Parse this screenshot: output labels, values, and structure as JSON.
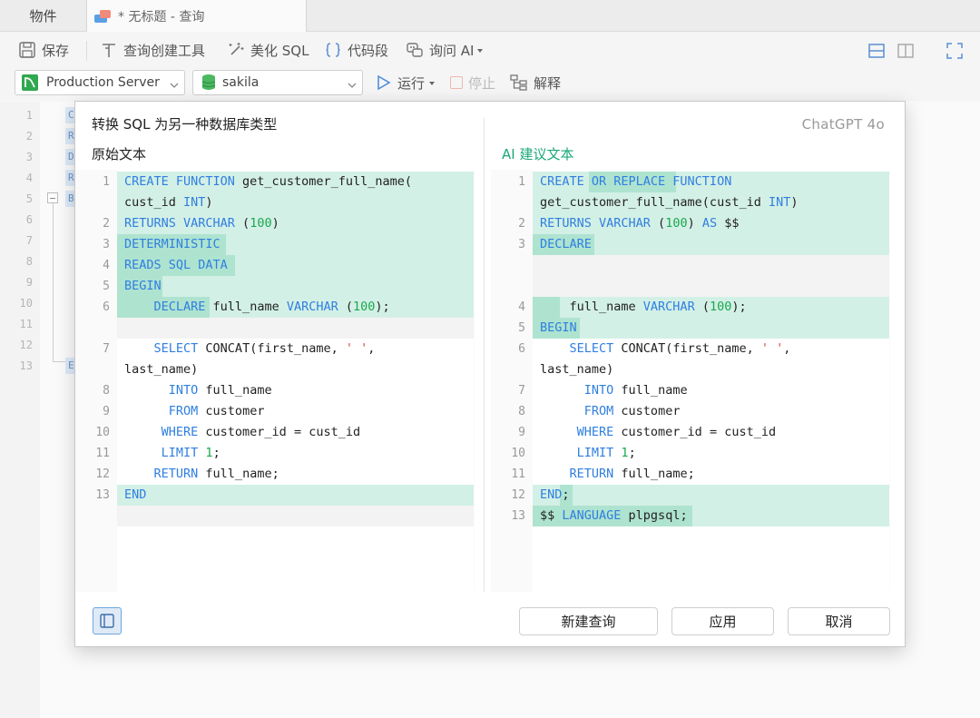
{
  "tabs": {
    "objects": "物件",
    "query": "* 无标题 - 查询"
  },
  "toolbar": {
    "save": "保存",
    "query_builder": "查询创建工具",
    "beautify": "美化 SQL",
    "snippet": "代码段",
    "ask_ai": "询问 AI"
  },
  "toolbar2": {
    "connection": "Production Server",
    "database": "sakila",
    "run": "运行",
    "stop": "停止",
    "explain": "解释"
  },
  "editor": {
    "line_numbers": [
      "1",
      "2",
      "3",
      "4",
      "5",
      "6",
      "7",
      "8",
      "9",
      "10",
      "11",
      "12",
      "13"
    ],
    "fragments": [
      "C",
      "R",
      "D",
      "R",
      "B",
      "E"
    ]
  },
  "dialog": {
    "title": "转换 SQL 为另一种数据库类型",
    "model": "ChatGPT 4o",
    "left_label": "原始文本",
    "right_label": "AI 建议文本",
    "buttons": {
      "new_query": "新建查询",
      "apply": "应用",
      "cancel": "取消"
    }
  },
  "original_code": [
    {
      "n": "1",
      "parts": [
        [
          "k",
          "CREATE FUNCTION"
        ],
        [
          "t",
          " get_customer_full_name("
        ]
      ]
    },
    {
      "n": "",
      "parts": [
        [
          "t",
          "cust_id "
        ],
        [
          "k",
          "INT"
        ],
        [
          "t",
          ")"
        ]
      ]
    },
    {
      "n": "2",
      "parts": [
        [
          "k",
          "RETURNS VARCHAR"
        ],
        [
          "t",
          " ("
        ],
        [
          "n",
          "100"
        ],
        [
          "t",
          ")"
        ]
      ]
    },
    {
      "n": "3",
      "parts": [
        [
          "k",
          "DETERMINISTIC"
        ]
      ]
    },
    {
      "n": "4",
      "parts": [
        [
          "k",
          "READS SQL DATA"
        ]
      ]
    },
    {
      "n": "5",
      "parts": [
        [
          "k",
          "BEGIN"
        ]
      ]
    },
    {
      "n": "6",
      "parts": [
        [
          "t",
          "    "
        ],
        [
          "k",
          "DECLARE"
        ],
        [
          "t",
          " full_name "
        ],
        [
          "k",
          "VARCHAR"
        ],
        [
          "t",
          " ("
        ],
        [
          "n",
          "100"
        ],
        [
          "t",
          ");"
        ]
      ]
    },
    {
      "n": "",
      "parts": []
    },
    {
      "n": "7",
      "parts": [
        [
          "t",
          "    "
        ],
        [
          "k",
          "SELECT"
        ],
        [
          "t",
          " CONCAT(first_name, "
        ],
        [
          "s",
          "' '"
        ],
        [
          "t",
          ","
        ]
      ]
    },
    {
      "n": "",
      "parts": [
        [
          "t",
          "last_name)"
        ]
      ]
    },
    {
      "n": "8",
      "parts": [
        [
          "t",
          "      "
        ],
        [
          "k",
          "INTO"
        ],
        [
          "t",
          " full_name"
        ]
      ]
    },
    {
      "n": "9",
      "parts": [
        [
          "t",
          "      "
        ],
        [
          "k",
          "FROM"
        ],
        [
          "t",
          " customer"
        ]
      ]
    },
    {
      "n": "10",
      "parts": [
        [
          "t",
          "     "
        ],
        [
          "k",
          "WHERE"
        ],
        [
          "t",
          " customer_id = cust_id"
        ]
      ]
    },
    {
      "n": "11",
      "parts": [
        [
          "t",
          "     "
        ],
        [
          "k",
          "LIMIT"
        ],
        [
          "t",
          " "
        ],
        [
          "n",
          "1"
        ],
        [
          "t",
          ";"
        ]
      ]
    },
    {
      "n": "12",
      "parts": [
        [
          "t",
          "    "
        ],
        [
          "k",
          "RETURN"
        ],
        [
          "t",
          " full_name;"
        ]
      ]
    },
    {
      "n": "13",
      "parts": [
        [
          "k",
          "END"
        ]
      ]
    }
  ],
  "suggested_code": [
    {
      "n": "1",
      "parts": [
        [
          "k",
          "CREATE OR REPLACE FUNCTION"
        ]
      ]
    },
    {
      "n": "",
      "parts": [
        [
          "t",
          "get_customer_full_name(cust_id "
        ],
        [
          "k",
          "INT"
        ],
        [
          "t",
          ")"
        ]
      ]
    },
    {
      "n": "2",
      "parts": [
        [
          "k",
          "RETURNS VARCHAR"
        ],
        [
          "t",
          " ("
        ],
        [
          "n",
          "100"
        ],
        [
          "t",
          ") "
        ],
        [
          "k",
          "AS"
        ],
        [
          "t",
          " $$"
        ]
      ]
    },
    {
      "n": "3",
      "parts": [
        [
          "k",
          "DECLARE"
        ]
      ]
    },
    {
      "n": "",
      "parts": []
    },
    {
      "n": "",
      "parts": []
    },
    {
      "n": "4",
      "parts": [
        [
          "t",
          "    full_name "
        ],
        [
          "k",
          "VARCHAR"
        ],
        [
          "t",
          " ("
        ],
        [
          "n",
          "100"
        ],
        [
          "t",
          ");"
        ]
      ]
    },
    {
      "n": "5",
      "parts": [
        [
          "k",
          "BEGIN"
        ]
      ]
    },
    {
      "n": "6",
      "parts": [
        [
          "t",
          "    "
        ],
        [
          "k",
          "SELECT"
        ],
        [
          "t",
          " CONCAT(first_name, "
        ],
        [
          "s",
          "' '"
        ],
        [
          "t",
          ","
        ]
      ]
    },
    {
      "n": "",
      "parts": [
        [
          "t",
          "last_name)"
        ]
      ]
    },
    {
      "n": "7",
      "parts": [
        [
          "t",
          "      "
        ],
        [
          "k",
          "INTO"
        ],
        [
          "t",
          " full_name"
        ]
      ]
    },
    {
      "n": "8",
      "parts": [
        [
          "t",
          "      "
        ],
        [
          "k",
          "FROM"
        ],
        [
          "t",
          " customer"
        ]
      ]
    },
    {
      "n": "9",
      "parts": [
        [
          "t",
          "     "
        ],
        [
          "k",
          "WHERE"
        ],
        [
          "t",
          " customer_id = cust_id"
        ]
      ]
    },
    {
      "n": "10",
      "parts": [
        [
          "t",
          "     "
        ],
        [
          "k",
          "LIMIT"
        ],
        [
          "t",
          " "
        ],
        [
          "n",
          "1"
        ],
        [
          "t",
          ";"
        ]
      ]
    },
    {
      "n": "11",
      "parts": [
        [
          "t",
          "    "
        ],
        [
          "k",
          "RETURN"
        ],
        [
          "t",
          " full_name;"
        ]
      ]
    },
    {
      "n": "12",
      "parts": [
        [
          "k",
          "END"
        ],
        [
          "t",
          ";"
        ]
      ]
    },
    {
      "n": "13",
      "parts": [
        [
          "t",
          "$$ "
        ],
        [
          "k",
          "LANGUAGE"
        ],
        [
          "t",
          " plpgsql;"
        ]
      ]
    }
  ],
  "colors": {
    "keyword": "#2f7fe0",
    "number": "#1ba84e",
    "string": "#d8473a",
    "diff_highlight": "#d3f0e6",
    "diff_word": "#aee3d0",
    "ai_label": "#1aa77a"
  }
}
